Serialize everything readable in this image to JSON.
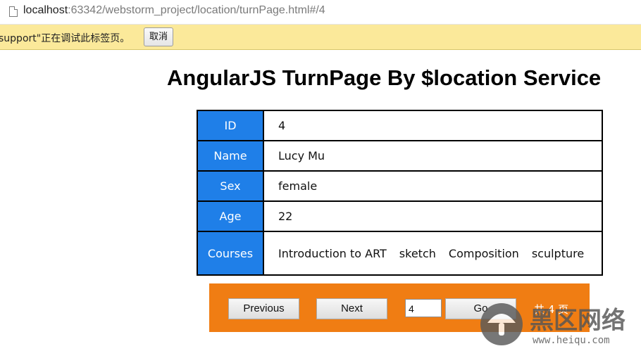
{
  "browser": {
    "url_host": "localhost",
    "url_rest": ":63342/webstorm_project/location/turnPage.html#/4"
  },
  "infobar": {
    "message": "support\"正在调试此标签页。",
    "cancel_label": "取消"
  },
  "page": {
    "title": "AngularJS TurnPage By $location Service"
  },
  "detail": {
    "rows": [
      {
        "key": "ID",
        "value": "4"
      },
      {
        "key": "Name",
        "value": "Lucy Mu"
      },
      {
        "key": "Sex",
        "value": "female"
      },
      {
        "key": "Age",
        "value": "22"
      }
    ],
    "courses_key": "Courses",
    "courses": [
      "Introduction to ART",
      "sketch",
      "Composition",
      "sculpture"
    ]
  },
  "pager": {
    "previous_label": "Previous",
    "next_label": "Next",
    "page_value": "4",
    "go_label": "Go",
    "total_text": "共 4 页"
  },
  "watermark": {
    "title": "黑区网络",
    "domain": "www.heiqu.com"
  },
  "colors": {
    "key_cell": "#1f7fe8",
    "pager_bg": "#f07d13",
    "infobar_bg": "#fbe99a"
  }
}
